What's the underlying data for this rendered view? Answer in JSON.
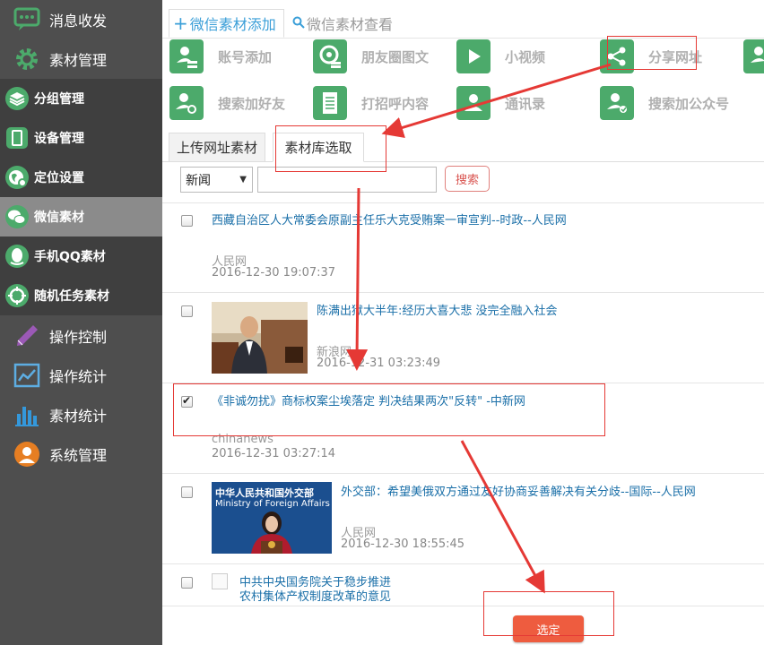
{
  "sidebar": {
    "top_items": [
      {
        "label": "消息收发",
        "icon": "chat-icon"
      },
      {
        "label": "素材管理",
        "icon": "gear-icon"
      }
    ],
    "sub_items": [
      {
        "label": "分组管理",
        "icon": "layers-icon"
      },
      {
        "label": "设备管理",
        "icon": "phone-icon"
      },
      {
        "label": "定位设置",
        "icon": "globe-icon"
      },
      {
        "label": "微信素材",
        "icon": "wechat-icon"
      },
      {
        "label": "手机QQ素材",
        "icon": "qq-icon"
      },
      {
        "label": "随机任务素材",
        "icon": "random-task-icon"
      }
    ],
    "bottom_items": [
      {
        "label": "操作控制",
        "icon": "pencil-icon"
      },
      {
        "label": "操作统计",
        "icon": "line-chart-icon"
      },
      {
        "label": "素材统计",
        "icon": "bar-chart-icon"
      },
      {
        "label": "系统管理",
        "icon": "user-icon"
      }
    ]
  },
  "tabs": {
    "add": "微信素材添加",
    "view": "微信素材查看"
  },
  "functions": [
    {
      "label": "账号添加",
      "icon": "user-add-icon"
    },
    {
      "label": "朋友圈图文",
      "icon": "moments-icon"
    },
    {
      "label": "小视频",
      "icon": "play-icon"
    },
    {
      "label": "分享网址",
      "icon": "share-icon"
    },
    {
      "label": "",
      "icon": "user-share-icon"
    },
    {
      "label": "搜索加好友",
      "icon": "search-user-icon"
    },
    {
      "label": "打招呼内容",
      "icon": "document-icon"
    },
    {
      "label": "通讯录",
      "icon": "contacts-icon"
    },
    {
      "label": "搜索加公众号",
      "icon": "official-account-icon"
    }
  ],
  "sub_tabs": {
    "upload": "上传网址素材",
    "library": "素材库选取"
  },
  "search": {
    "category": "新闻",
    "button": "搜索"
  },
  "news": [
    {
      "title": "西藏自治区人大常委会原副主任乐大克受贿案一审宣判--时政--人民网",
      "source": "人民网",
      "time": "2016-12-30 19:07:37",
      "checked": false
    },
    {
      "title": "陈满出狱大半年:经历大喜大悲 没完全融入社会",
      "source": "新浪网",
      "time": "2016-12-31 03:23:49",
      "checked": false
    },
    {
      "title": "《非诚勿扰》商标权案尘埃落定 判决结果两次\"反转\" -中新网",
      "source": "chinanews",
      "time": "2016-12-31 03:27:14",
      "checked": true
    },
    {
      "title": "外交部：希望美俄双方通过友好协商妥善解决有关分歧--国际--人民网",
      "source": "人民网",
      "time": "2016-12-30 18:55:45",
      "checked": false,
      "thumb_text": "中华人民共和国外交部",
      "thumb_sub": "Ministry of Foreign Affairs"
    },
    {
      "title_line1": "中共中央国务院关于稳步推进",
      "title_line2": "农村集体产权制度改革的意见",
      "checked": false
    }
  ],
  "confirm_button": "选定",
  "colors": {
    "sidebar_bg": "#4e4e4e",
    "accent_green": "#4caa6b",
    "link_blue": "#1a6fa8",
    "confirm_red": "#ee5c3f",
    "annotation_red": "#e53935"
  }
}
